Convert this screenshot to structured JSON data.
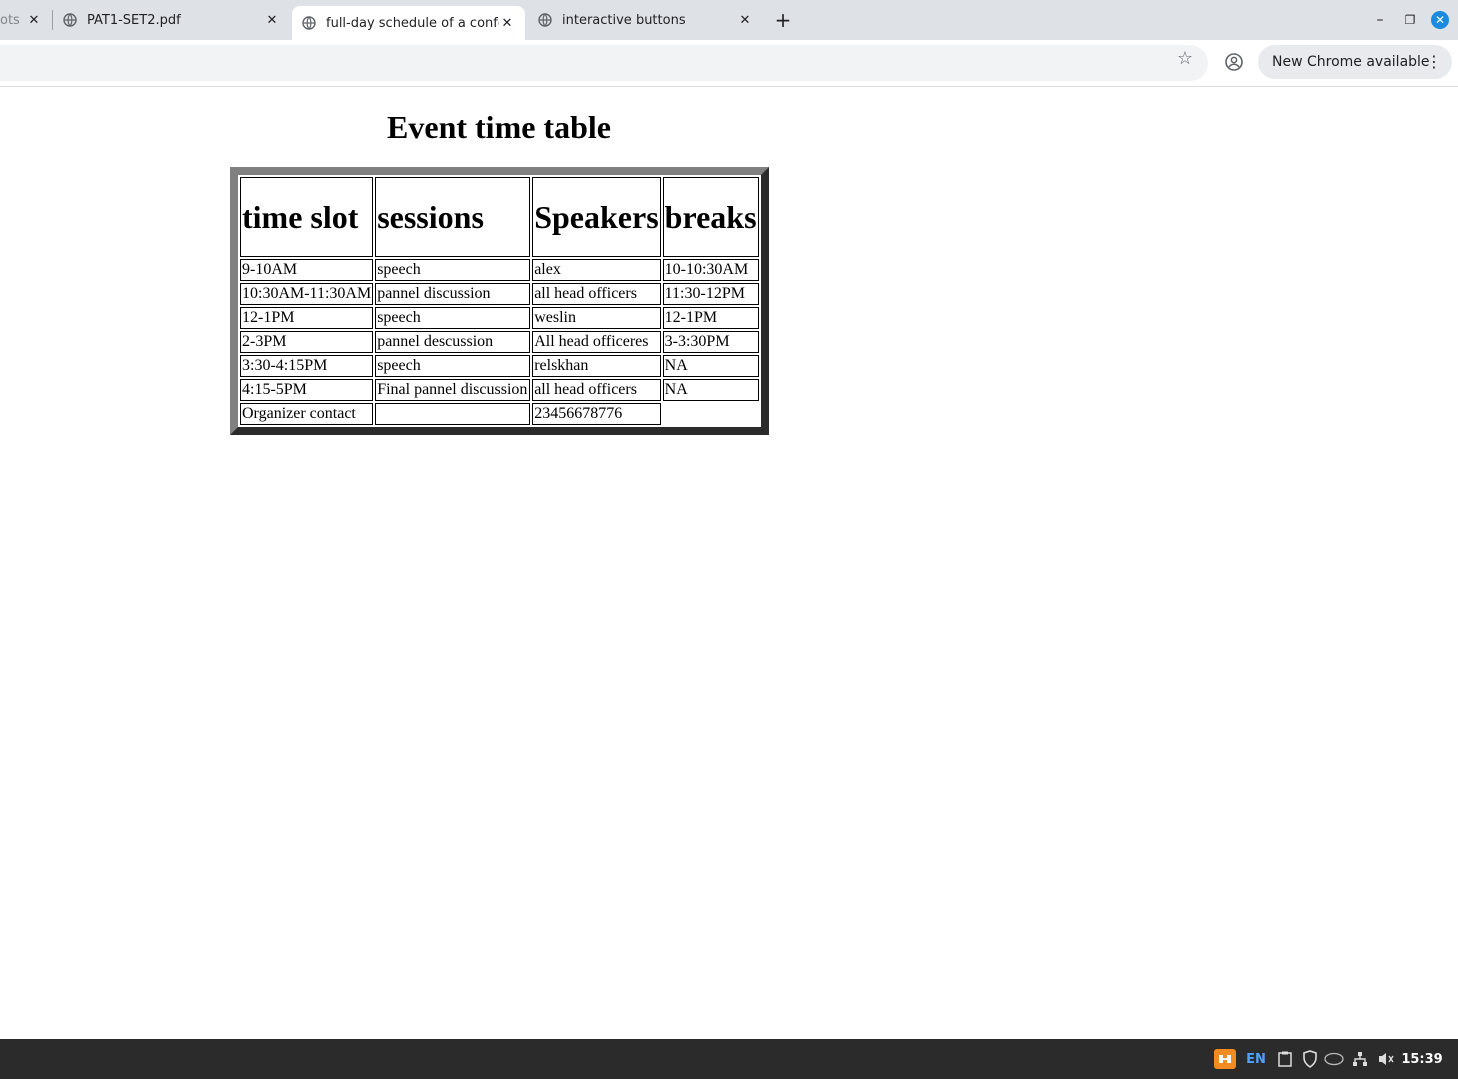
{
  "browser": {
    "tabs": [
      {
        "title": "ots",
        "active": false
      },
      {
        "title": "PAT1-SET2.pdf",
        "active": false
      },
      {
        "title": "full-day schedule of a conference",
        "active": true
      },
      {
        "title": "interactive buttons",
        "active": false
      }
    ],
    "tab_close_glyph": "✕",
    "new_tab_glyph": "+",
    "update_chip_label": "New Chrome available",
    "window_controls": {
      "minimize": "–",
      "restore": "❐",
      "close": "✕"
    }
  },
  "page": {
    "title": "Event time table",
    "table": {
      "headers": [
        "time slot",
        "sessions",
        "Speakers",
        "breaks"
      ],
      "rows": [
        [
          "9-10AM",
          "speech",
          "alex",
          "10-10:30AM"
        ],
        [
          "10:30AM-11:30AM",
          "pannel discussion",
          "all head officers",
          "11:30-12PM"
        ],
        [
          "12-1PM",
          "speech",
          "weslin",
          "12-1PM"
        ],
        [
          "2-3PM",
          "pannel descussion",
          "All head officeres",
          "3-3:30PM"
        ],
        [
          "3:30-4:15PM",
          "speech",
          "relskhan",
          "NA"
        ],
        [
          "4:15-5PM",
          "Final pannel discussion",
          "all head officers",
          "NA"
        ],
        [
          "Organizer contact",
          "",
          "23456678776"
        ]
      ]
    }
  },
  "taskbar": {
    "language": "EN",
    "clock": "15:39",
    "tray_icons": [
      "app-icon",
      "clipboard-icon",
      "shield-icon",
      "intel-icon",
      "network-icon",
      "volume-icon"
    ]
  },
  "colors": {
    "tabstrip_bg": "#dee1e6",
    "taskbar_bg": "#2b2b2b",
    "table_border_light": "#808080",
    "table_border_dark": "#2b2b2b",
    "close_button": "#1a8be0"
  }
}
